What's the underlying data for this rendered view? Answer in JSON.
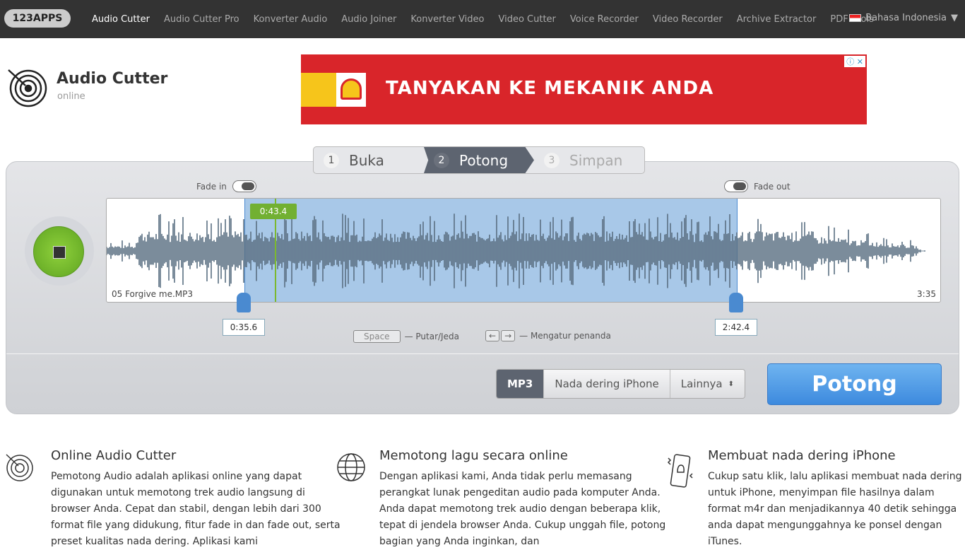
{
  "nav": {
    "logo": "123APPS",
    "items": [
      "Audio Cutter",
      "Audio Cutter Pro",
      "Konverter Audio",
      "Audio Joiner",
      "Konverter Video",
      "Video Cutter",
      "Voice Recorder",
      "Video Recorder",
      "Archive Extractor",
      "PDF Tools"
    ],
    "active": "Audio Cutter",
    "language": "Bahasa Indonesia"
  },
  "brand": {
    "title": "Audio Cutter",
    "subtitle": "online"
  },
  "ad": {
    "text": "TANYAKAN KE MEKANIK ANDA",
    "brand": "Shell"
  },
  "steps": [
    {
      "num": "1",
      "label": "Buka"
    },
    {
      "num": "2",
      "label": "Potong"
    },
    {
      "num": "3",
      "label": "Simpan"
    }
  ],
  "editor": {
    "fade_in": "Fade in",
    "fade_out": "Fade out",
    "file_name": "05 Forgive me.MP3",
    "duration": "3:35",
    "playhead_time": "0:43.4",
    "start_time": "0:35.6",
    "end_time": "2:42.4",
    "hint_space_key": "Space",
    "hint_space": "— Putar/Jeda",
    "hint_arrows_left": "←",
    "hint_arrows_right": "→",
    "hint_arrows": "— Mengatur penanda",
    "fade_in_enabled": false,
    "fade_out_enabled": false
  },
  "formats": {
    "options": [
      "MP3",
      "Nada dering iPhone",
      "Lainnya"
    ],
    "selected": "MP3"
  },
  "cut_button": "Potong",
  "colors": {
    "accent": "#4a8ad0",
    "play": "#72b032",
    "nav_bg": "#333333"
  },
  "features": [
    {
      "title": "Online Audio Cutter",
      "text": "Pemotong Audio adalah aplikasi online yang dapat digunakan untuk memotong trek audio langsung di browser Anda. Cepat dan stabil, dengan lebih dari 300 format file yang didukung, fitur fade in dan fade out, serta preset kualitas nada dering. Aplikasi kami"
    },
    {
      "title": "Memotong lagu secara online",
      "text": "Dengan aplikasi kami, Anda tidak perlu memasang perangkat lunak pengeditan audio pada komputer Anda. Anda dapat memotong trek audio dengan beberapa klik, tepat di jendela browser Anda. Cukup unggah file, potong bagian yang Anda inginkan, dan"
    },
    {
      "title": "Membuat nada dering iPhone",
      "text": "Cukup satu klik, lalu aplikasi membuat nada dering untuk iPhone, menyimpan file hasilnya dalam format m4r dan menjadikannya 40 detik sehingga anda dapat mengunggahnya ke ponsel dengan iTunes."
    }
  ]
}
